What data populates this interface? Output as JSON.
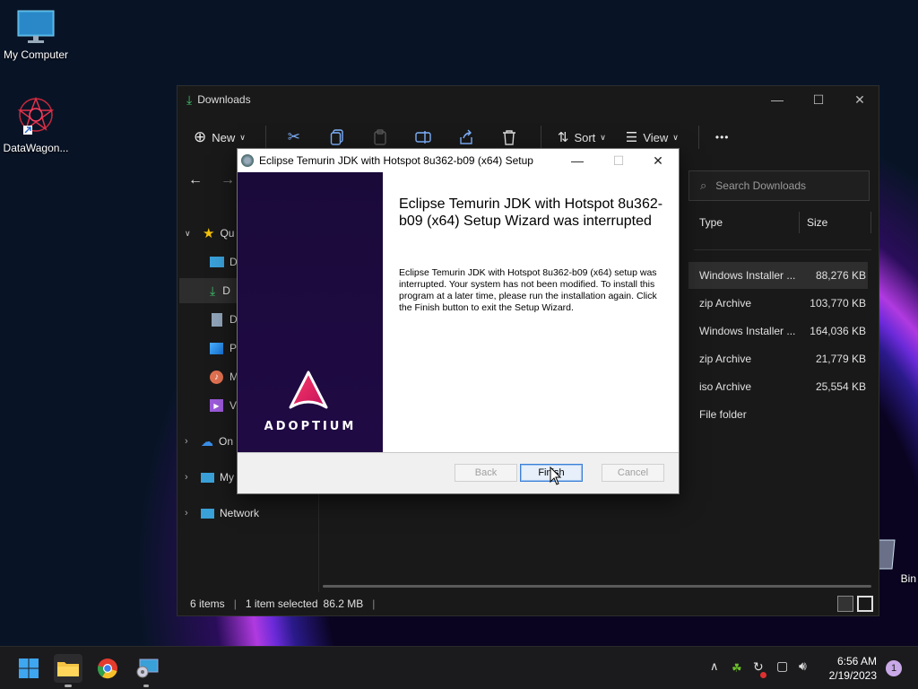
{
  "desktop": {
    "icons": [
      {
        "label": "My Computer",
        "icon": "monitor-icon"
      },
      {
        "label": "DataWagon...",
        "icon": "datawagon-icon"
      },
      {
        "label": "Bin",
        "icon": "recycle-bin-icon"
      }
    ]
  },
  "explorer": {
    "title": "Downloads",
    "toolbar": {
      "new_label": "New",
      "sort_label": "Sort",
      "view_label": "View",
      "more_label": "•••"
    },
    "search_placeholder": "Search Downloads",
    "sidebar": [
      {
        "label": "Qu",
        "icon": "star-icon"
      },
      {
        "label": "D",
        "icon": "desktop-icon"
      },
      {
        "label": "D",
        "icon": "download-icon"
      },
      {
        "label": "D",
        "icon": "documents-icon"
      },
      {
        "label": "Pi",
        "icon": "pictures-icon"
      },
      {
        "label": "M",
        "icon": "music-icon"
      },
      {
        "label": "Vi",
        "icon": "videos-icon"
      },
      {
        "label": "On",
        "icon": "cloud-icon"
      },
      {
        "label": "My",
        "icon": "computer-icon"
      },
      {
        "label": "Network",
        "icon": "network-icon"
      }
    ],
    "columns": {
      "type": "Type",
      "size": "Size"
    },
    "rows": [
      {
        "type": "Windows Installer ...",
        "size": "88,276 KB",
        "selected": true
      },
      {
        "type": "zip Archive",
        "size": "103,770 KB"
      },
      {
        "type": "Windows Installer ...",
        "size": "164,036 KB"
      },
      {
        "type": "zip Archive",
        "size": "21,779 KB"
      },
      {
        "type": "iso Archive",
        "size": "25,554 KB"
      },
      {
        "type": "File folder",
        "size": ""
      }
    ],
    "status": {
      "items": "6 items",
      "selected": "1 item selected",
      "selected_size": "86.2 MB"
    }
  },
  "dialog": {
    "title": "Eclipse Temurin JDK with Hotspot 8u362-b09 (x64) Setup",
    "heading": "Eclipse Temurin JDK with Hotspot 8u362-b09 (x64) Setup Wizard was interrupted",
    "body": "Eclipse Temurin JDK with Hotspot 8u362-b09 (x64) setup was interrupted. Your system has not been modified. To install this program at a later time, please run the installation again. Click the Finish button to exit the Setup Wizard.",
    "brand": "ADOPTIUM",
    "buttons": {
      "back": "Back",
      "finish": "Finish",
      "cancel": "Cancel"
    }
  },
  "taskbar": {
    "time": "6:56 AM",
    "date": "2/19/2023",
    "notification_count": "1"
  }
}
